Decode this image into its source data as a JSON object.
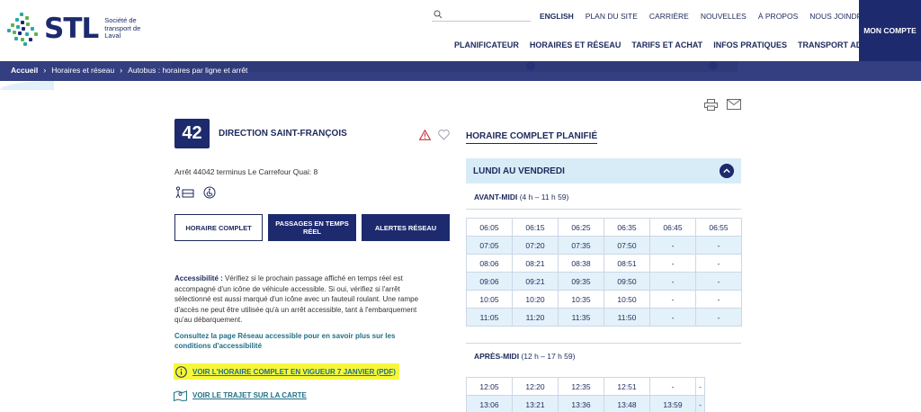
{
  "header": {
    "logo_text": "STL",
    "logo_sub": "Société de transport de Laval",
    "top_links": [
      "ENGLISH",
      "PLAN DU SITE",
      "CARRIÈRE",
      "NOUVELLES",
      "À PROPOS",
      "NOUS JOINDRE"
    ],
    "main_nav": [
      "PLANIFICATEUR",
      "HORAIRES ET RÉSEAU",
      "TARIFS ET ACHAT",
      "INFOS PRATIQUES",
      "TRANSPORT ADAPTÉ"
    ],
    "account_label": "MON COMPTE",
    "colors": {
      "navy": "#1d2a6e",
      "band": "#333f80",
      "link": "#1f6f86",
      "highlight": "#f6f73a"
    }
  },
  "breadcrumb": [
    "Accueil",
    "Horaires et réseau",
    "Autobus : horaires par ligne et arrêt"
  ],
  "route": {
    "number": "42",
    "direction": "DIRECTION SAINT-FRANÇOIS",
    "stop": "Arrêt 44042  terminus Le Carrefour Quai: 8"
  },
  "buttons": {
    "full_schedule": "HORAIRE COMPLET",
    "realtime": "PASSAGES EN TEMPS RÉEL",
    "alerts": "ALERTES RÉSEAU"
  },
  "accessibility": {
    "label": "Accessibilité :",
    "text": "Vérifiez si le prochain passage affiché en temps réel est accompagné d'un icône de véhicule accessible. Si oui, vérifiez si l'arrêt sélectionné est aussi marqué d'un icône avec un fauteuil roulant. Une rampe d'accès ne peut être utilisée qu'à un arrêt accessible, tant à l'embarquement qu'au débarquement.",
    "link": "Consultez la page Réseau accessible pour en savoir plus sur les conditions d'accessibilité"
  },
  "links": {
    "pdf": "VOIR L'HORAIRE COMPLET EN VIGUEUR 7 JANVIER (PDF)",
    "map": "VOIR LE TRAJET SUR LA CARTE"
  },
  "schedule": {
    "title": "HORAIRE COMPLET PLANIFIÉ",
    "day": "LUNDI AU VENDREDI",
    "am_label": "AVANT-MIDI",
    "am_range": "(4 h – 11 h 59)",
    "am_rows": [
      [
        "06:05",
        "06:15",
        "06:25",
        "06:35",
        "06:45",
        "06:55"
      ],
      [
        "07:05",
        "07:20",
        "07:35",
        "07:50",
        "-",
        "-"
      ],
      [
        "08:06",
        "08:21",
        "08:38",
        "08:51",
        "-",
        "-"
      ],
      [
        "09:06",
        "09:21",
        "09:35",
        "09:50",
        "-",
        "-"
      ],
      [
        "10:05",
        "10:20",
        "10:35",
        "10:50",
        "-",
        "-"
      ],
      [
        "11:05",
        "11:20",
        "11:35",
        "11:50",
        "-",
        "-"
      ]
    ],
    "pm_label": "APRÈS-MIDI",
    "pm_range": "(12 h – 17 h 59)",
    "pm_rows": [
      [
        "12:05",
        "12:20",
        "12:35",
        "12:51",
        "-",
        "-"
      ],
      [
        "13:06",
        "13:21",
        "13:36",
        "13:48",
        "13:59",
        "-"
      ]
    ]
  }
}
